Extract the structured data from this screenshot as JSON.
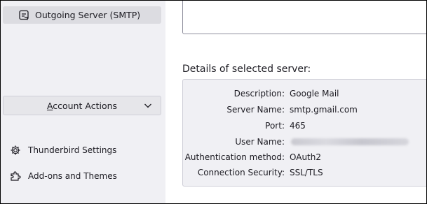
{
  "sidebar": {
    "selected_item": {
      "label": "Outgoing Server (SMTP)",
      "icon": "outgoing-server-icon"
    },
    "account_actions": {
      "label_prefix": "",
      "label_accel": "A",
      "label_rest": "ccount Actions",
      "icon": "chevron-down-icon"
    },
    "bottom_items": [
      {
        "label": "Thunderbird Settings",
        "icon": "gear-icon"
      },
      {
        "label": "Add-ons and Themes",
        "icon": "puzzle-icon"
      }
    ]
  },
  "details": {
    "heading": "Details of selected server:",
    "rows": [
      {
        "key": "Description:",
        "value": "Google Mail"
      },
      {
        "key": "Server Name:",
        "value": "smtp.gmail.com"
      },
      {
        "key": "Port:",
        "value": "465"
      },
      {
        "key": "User Name:",
        "value": ""
      },
      {
        "key": "Authentication method:",
        "value": "OAuth2"
      },
      {
        "key": "Connection Security:",
        "value": "SSL/TLS"
      }
    ]
  }
}
